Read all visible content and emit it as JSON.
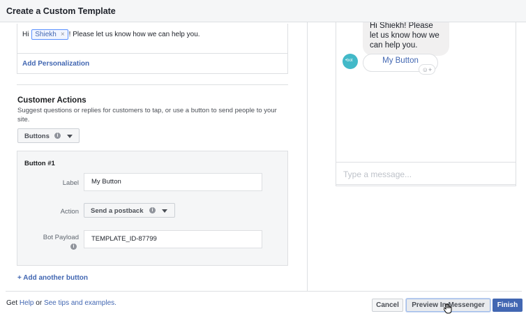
{
  "dialog": {
    "title": "Create a Custom Template"
  },
  "message": {
    "prefix": "Hi",
    "token": "Shiekh",
    "token_close": "×",
    "suffix": "! Please let us know how we can help you.",
    "add_personalization": "Add Personalization"
  },
  "customer_actions": {
    "title": "Customer Actions",
    "description": "Suggest questions or replies for customers to tap, or use a button to send people to your site.",
    "type_selected": "Buttons"
  },
  "button1": {
    "heading": "Button #1",
    "label_label": "Label",
    "label_value": "My Button",
    "action_label": "Action",
    "action_value": "Send a postback",
    "payload_label": "Bot Payload",
    "payload_value": "TEMPLATE_ID-87799"
  },
  "add_another_button": "+ Add another button",
  "footer": {
    "get": "Get",
    "help": "Help",
    "or": "or",
    "tips": "See tips and examples.",
    "cancel": "Cancel",
    "preview": "Preview In Messenger",
    "finish": "Finish"
  },
  "preview": {
    "bubble_text": "Hi Shiekh! Please let us know how we can help you.",
    "button_label": "My Button",
    "input_placeholder": "Type a message..."
  },
  "colors": {
    "link": "#4267b2",
    "finish_bg": "#4267b2",
    "avatar": "#42b9c8"
  }
}
